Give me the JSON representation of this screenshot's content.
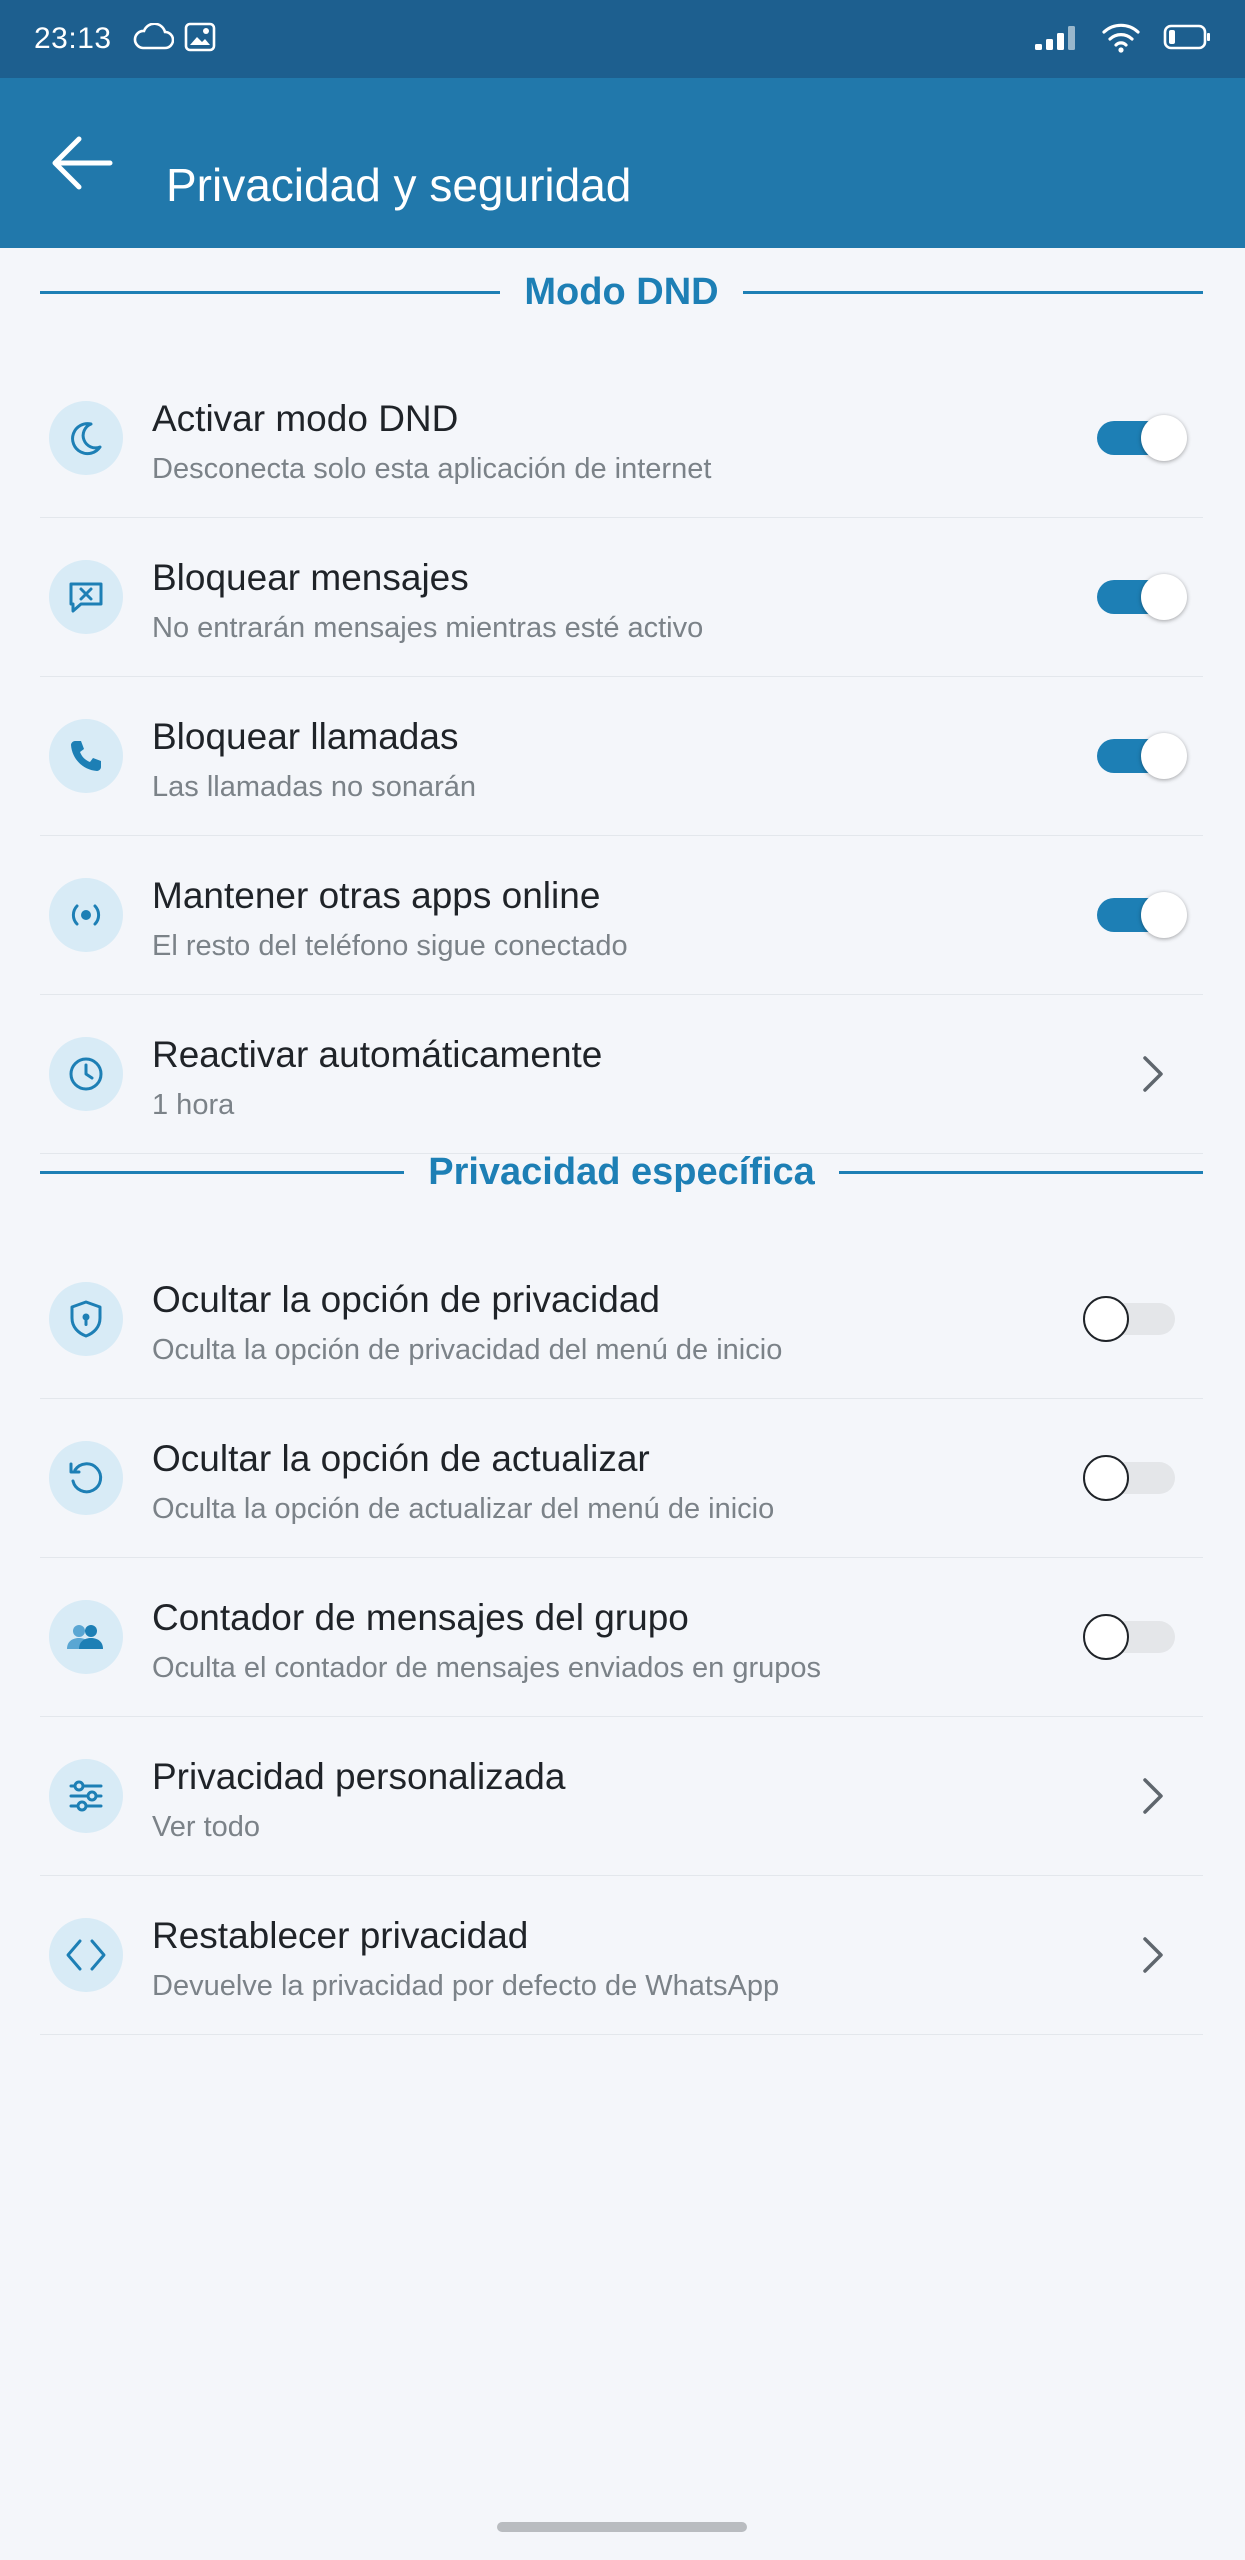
{
  "status_bar": {
    "time": "23:13",
    "left_icons": [
      "cloud-icon",
      "image-icon"
    ],
    "right_icons": [
      "signal-icon",
      "wifi-icon",
      "battery-icon"
    ]
  },
  "app_bar": {
    "title": "Privacidad y seguridad",
    "back_icon": "arrow-left-icon"
  },
  "sections": {
    "dnd": {
      "title": "Modo DND",
      "items": [
        {
          "title": "Activar modo DND",
          "subtitle": "Desconecta solo esta aplicación de internet",
          "icon": "moon-icon",
          "control": "toggle",
          "checked": true
        },
        {
          "title": "Bloquear mensajes",
          "subtitle": "No entrarán mensajes mientras esté activo",
          "icon": "message-block-icon",
          "control": "toggle",
          "checked": true
        },
        {
          "title": "Bloquear llamadas",
          "subtitle": "Las llamadas no sonarán",
          "icon": "phone-icon",
          "control": "toggle",
          "checked": true
        },
        {
          "title": "Mantener otras apps online",
          "subtitle": "El resto del teléfono sigue conectado",
          "icon": "broadcast-icon",
          "control": "toggle",
          "checked": true
        },
        {
          "title": "Reactivar automáticamente",
          "subtitle": "1 hora",
          "icon": "clock-icon",
          "control": "chevron"
        }
      ]
    },
    "privacy": {
      "title": "Privacidad específica",
      "items": [
        {
          "title": "Ocultar la opción de privacidad",
          "subtitle": "Oculta la opción de privacidad del menú de inicio",
          "icon": "shield-icon",
          "control": "toggle",
          "checked": false
        },
        {
          "title": "Ocultar la opción de actualizar",
          "subtitle": "Oculta la opción de actualizar del menú de inicio",
          "icon": "refresh-icon",
          "control": "toggle",
          "checked": false
        },
        {
          "title": "Contador de mensajes del grupo",
          "subtitle": "Oculta el contador de mensajes enviados en grupos",
          "icon": "group-icon",
          "control": "toggle",
          "checked": false
        },
        {
          "title": "Privacidad personalizada",
          "subtitle": "Ver todo",
          "icon": "sliders-icon",
          "control": "chevron"
        },
        {
          "title": "Restablecer privacidad",
          "subtitle": "Devuelve la privacidad por defecto de WhatsApp",
          "icon": "code-icon",
          "control": "chevron"
        }
      ]
    }
  },
  "colors": {
    "status_bar": "#1d5f8f",
    "app_bar": "#2178ab",
    "accent": "#1d7fb5",
    "icon_circle": "#d8ebf6",
    "background": "#f4f6fa"
  }
}
